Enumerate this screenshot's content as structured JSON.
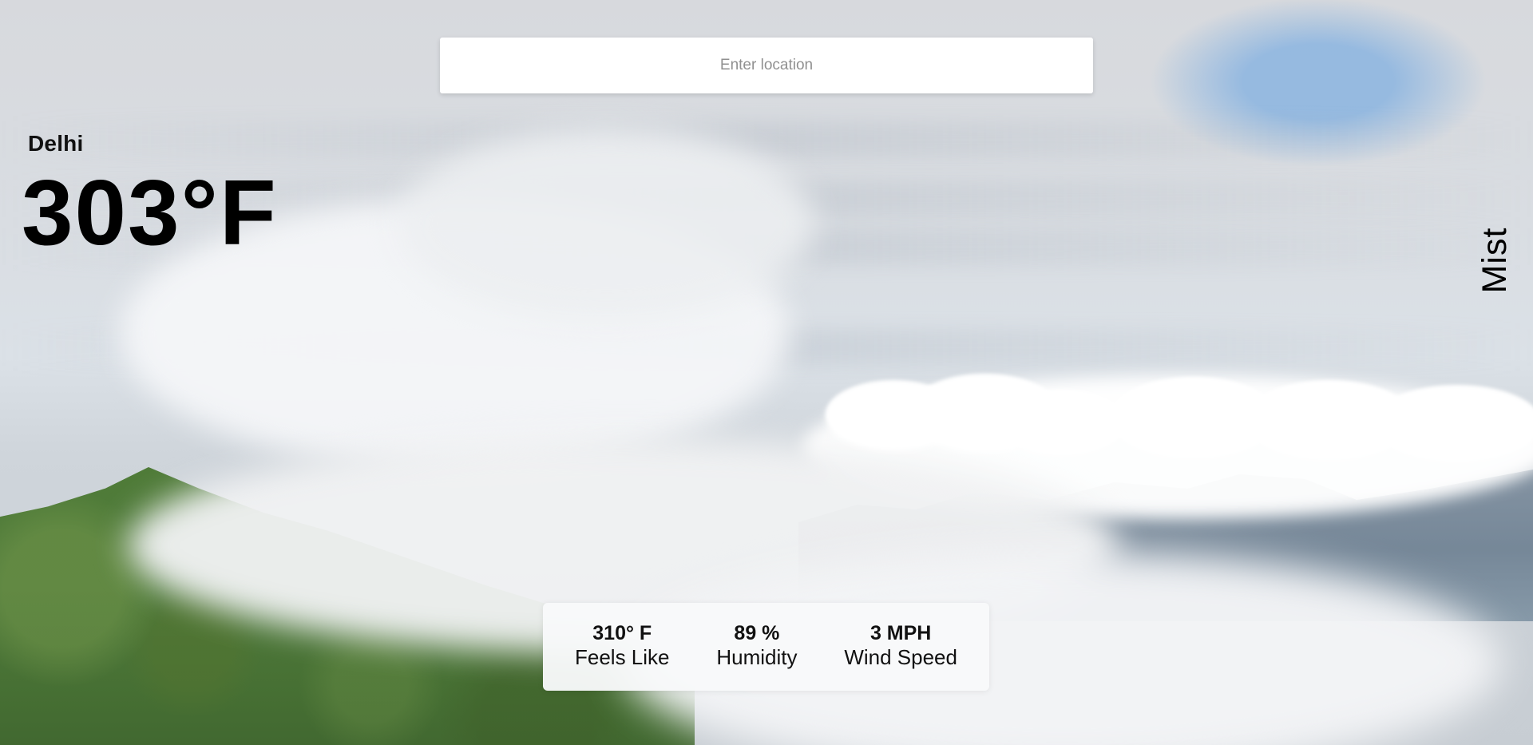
{
  "search": {
    "placeholder": "Enter location"
  },
  "weather": {
    "city": "Delhi",
    "temperature": "303°F",
    "condition": "Mist"
  },
  "stats": [
    {
      "value": "310° F",
      "label": "Feels Like"
    },
    {
      "value": "89 %",
      "label": "Humidity"
    },
    {
      "value": "3 MPH",
      "label": "Wind Speed"
    }
  ],
  "theme": {
    "text_color": "#000000",
    "panel_color": "#ffffff",
    "sky_blue": "#8ab4e0",
    "mountain_green": "#4f7b38"
  }
}
